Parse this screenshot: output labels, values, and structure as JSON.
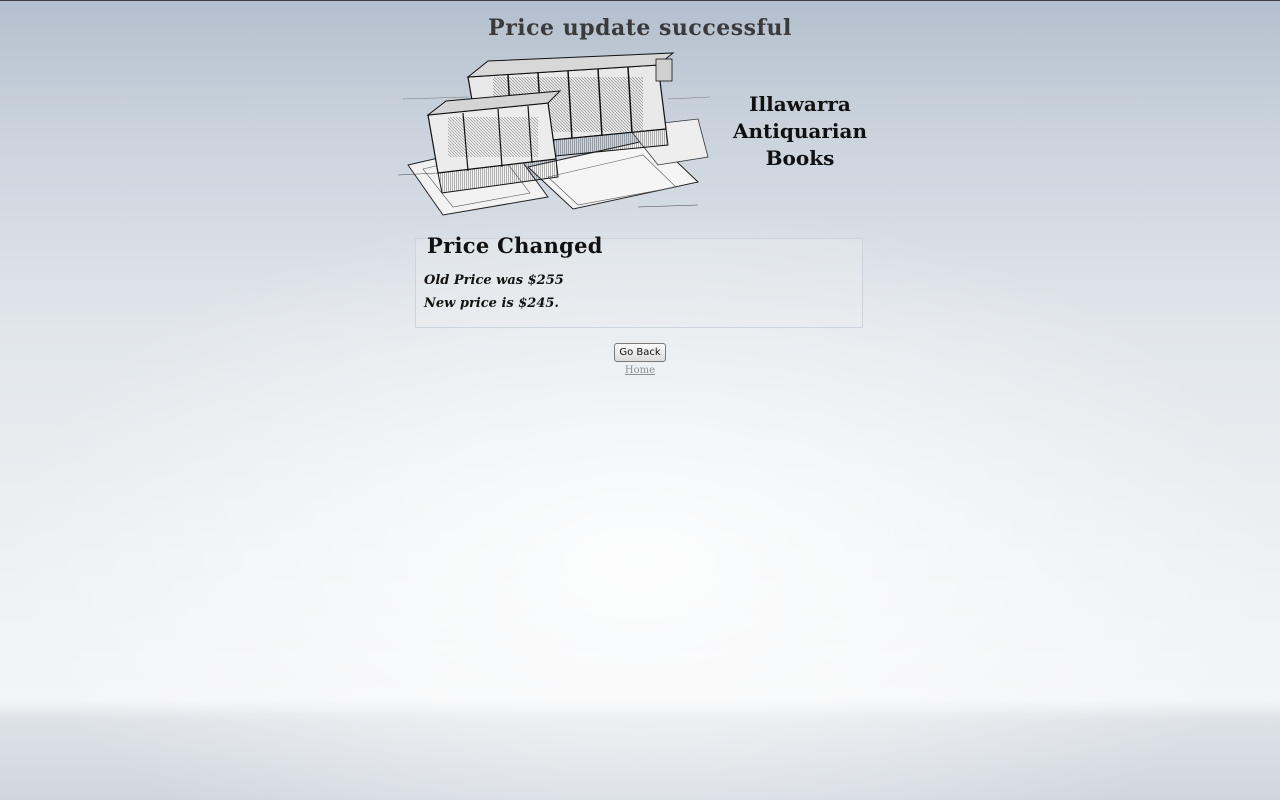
{
  "page": {
    "title": "Price update successful"
  },
  "banner": {
    "image_subject": "antique-books-engraving",
    "brand_line1": "Illawarra",
    "brand_line2": "Antiquarian",
    "brand_line3": "Books"
  },
  "result": {
    "legend": "Price Changed",
    "old_price_text": "Old Price was $255",
    "new_price_text": "New price is $245."
  },
  "actions": {
    "go_back_label": "Go Back",
    "home_label": "Home"
  }
}
